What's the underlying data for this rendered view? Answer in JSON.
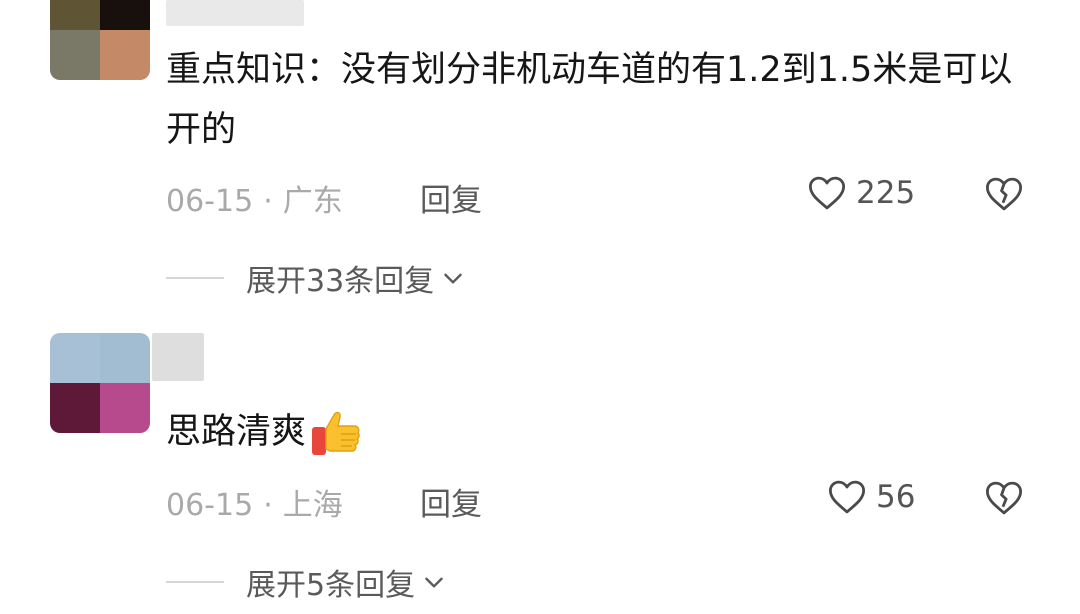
{
  "comments": [
    {
      "text": "重点知识：没有划分非机动车道的有1.2到1.5米是可以开的",
      "date": "06-15",
      "separator": "·",
      "location": "广东",
      "reply_label": "回复",
      "likes": "225",
      "expand_label": "展开33条回复",
      "avatar_colors": [
        "#5f5433",
        "#17100c",
        "#7a7968",
        "#c48a68"
      ]
    },
    {
      "text": "思路清爽",
      "date": "06-15",
      "separator": "·",
      "location": "上海",
      "reply_label": "回复",
      "likes": "56",
      "expand_label": "展开5条回复",
      "avatar_colors": [
        "#a7c0d6",
        "#a2bdd2",
        "#5e1838",
        "#b64a8c"
      ],
      "emoji": "thumbs-up-icon"
    }
  ]
}
